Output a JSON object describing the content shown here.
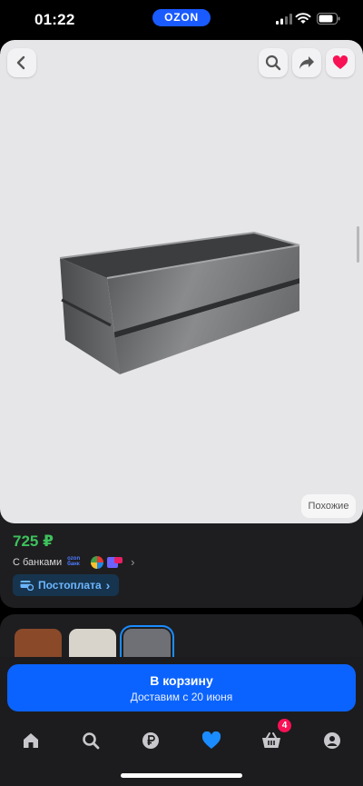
{
  "status_bar": {
    "time": "01:22",
    "brand_pill": "OZON"
  },
  "product": {
    "price": "725 ₽",
    "banks_label": "С банками",
    "bank_logo_text": "ozon банк",
    "postpay_label": "Постоплата",
    "similar_label": "Похожие"
  },
  "variants": {
    "swatches": [
      {
        "color": "#8a4a2a",
        "selected": false
      },
      {
        "color": "#d9d4cb",
        "selected": false
      },
      {
        "color": "#6e7075",
        "selected": true
      }
    ]
  },
  "cart": {
    "button_label": "В корзину",
    "delivery_text": "Доставим с 20 июня"
  },
  "tabbar": {
    "items": [
      {
        "icon": "home-icon",
        "active": false
      },
      {
        "icon": "search-icon",
        "active": false
      },
      {
        "icon": "ruble-icon",
        "active": false
      },
      {
        "icon": "heart-icon",
        "active": true
      },
      {
        "icon": "basket-icon",
        "active": false,
        "badge": "4"
      },
      {
        "icon": "profile-icon",
        "active": false
      }
    ]
  },
  "colors": {
    "accent": "#0b63ff",
    "price": "#3ec15c",
    "favorite": "#f91155",
    "active_tab": "#1a8cff"
  }
}
